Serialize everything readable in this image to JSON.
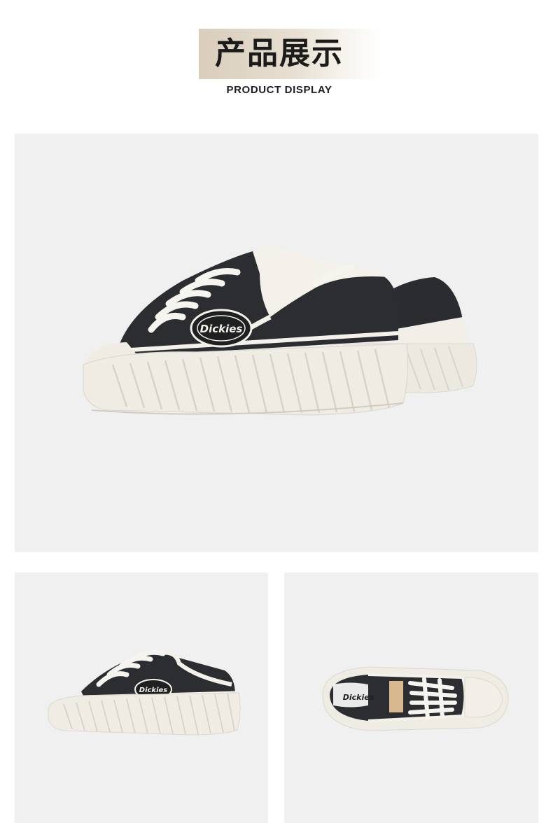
{
  "header": {
    "title_cn": "产品展示",
    "title_en": "PRODUCT DISPLAY"
  },
  "colors": {
    "plate": "#d9cdbb",
    "panel_bg": "#f0f0f0",
    "denim": "#2b2d30",
    "sole": "#efece4",
    "fleece": "#f4f1ea"
  },
  "product": {
    "brand_mark": "Dickies"
  },
  "images": [
    {
      "name": "pair-three-quarter-view",
      "icon": "sneaker-pair-image"
    },
    {
      "name": "side-view",
      "icon": "sneaker-side-image"
    },
    {
      "name": "top-view",
      "icon": "sneaker-top-image"
    }
  ]
}
